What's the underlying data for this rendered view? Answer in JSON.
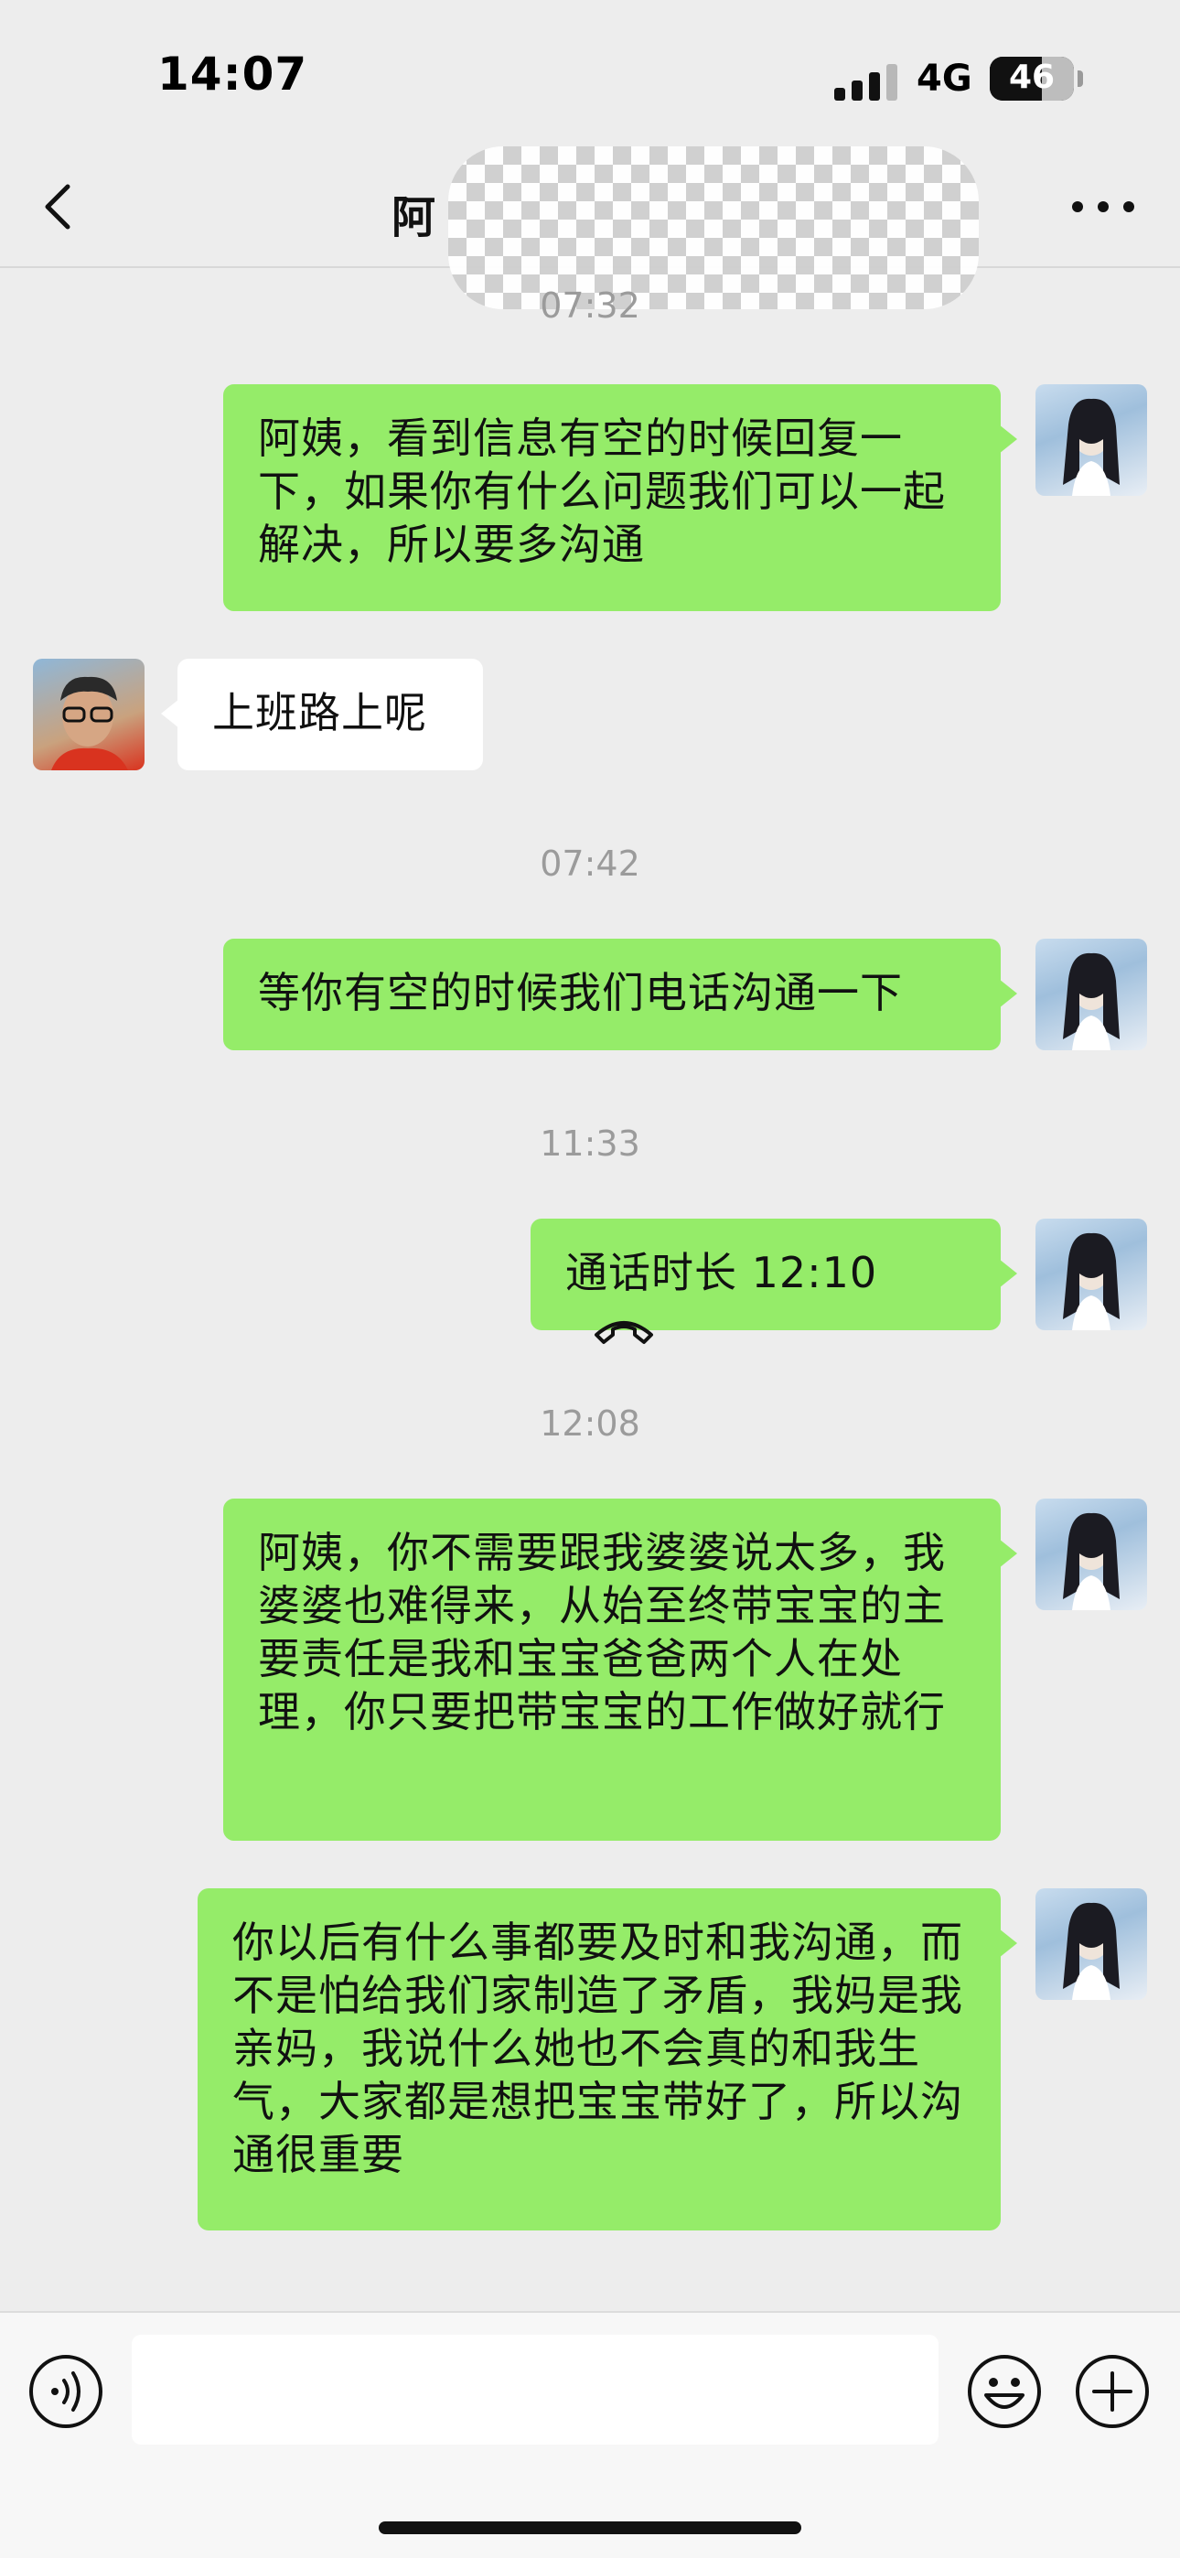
{
  "status_bar": {
    "time": "14:07",
    "network": "4G",
    "battery": "46",
    "battery_level_percent": 46,
    "signal_icon": "cellular-signal-icon"
  },
  "nav": {
    "title": "阿",
    "back_icon": "chevron-left-icon",
    "more_icon": "more-dots-icon"
  },
  "messages": [
    {
      "kind": "timestamp",
      "text": "07:32"
    },
    {
      "kind": "sent",
      "text": "阿姨，看到信息有空的时候回复一下，如果你有什么问题我们可以一起解决，所以要多沟通"
    },
    {
      "kind": "received",
      "text": "上班路上呢"
    },
    {
      "kind": "timestamp",
      "text": "07:42"
    },
    {
      "kind": "sent",
      "text": "等你有空的时候我们电话沟通一下"
    },
    {
      "kind": "timestamp",
      "text": "11:33"
    },
    {
      "kind": "call",
      "text": "通话时长 12:10",
      "icon": "phone-hangup-icon"
    },
    {
      "kind": "timestamp",
      "text": "12:08"
    },
    {
      "kind": "sent",
      "text": "阿姨，你不需要跟我婆婆说太多，我婆婆也难得来，从始至终带宝宝的主要责任是我和宝宝爸爸两个人在处理，你只要把带宝宝的工作做好就行"
    },
    {
      "kind": "sent",
      "text": "你以后有什么事都要及时和我沟通，而不是怕给我们家制造了矛盾，我妈是我亲妈，我说什么她也不会真的和我生气，大家都是想把宝宝带好了，所以沟通很重要"
    }
  ],
  "input_bar": {
    "value": "",
    "voice_icon": "voice-input-icon",
    "emoji_icon": "emoji-icon",
    "plus_icon": "plus-icon"
  },
  "colors": {
    "sent_bubble": "#95ec69",
    "received_bubble": "#ffffff",
    "background": "#ededed"
  }
}
